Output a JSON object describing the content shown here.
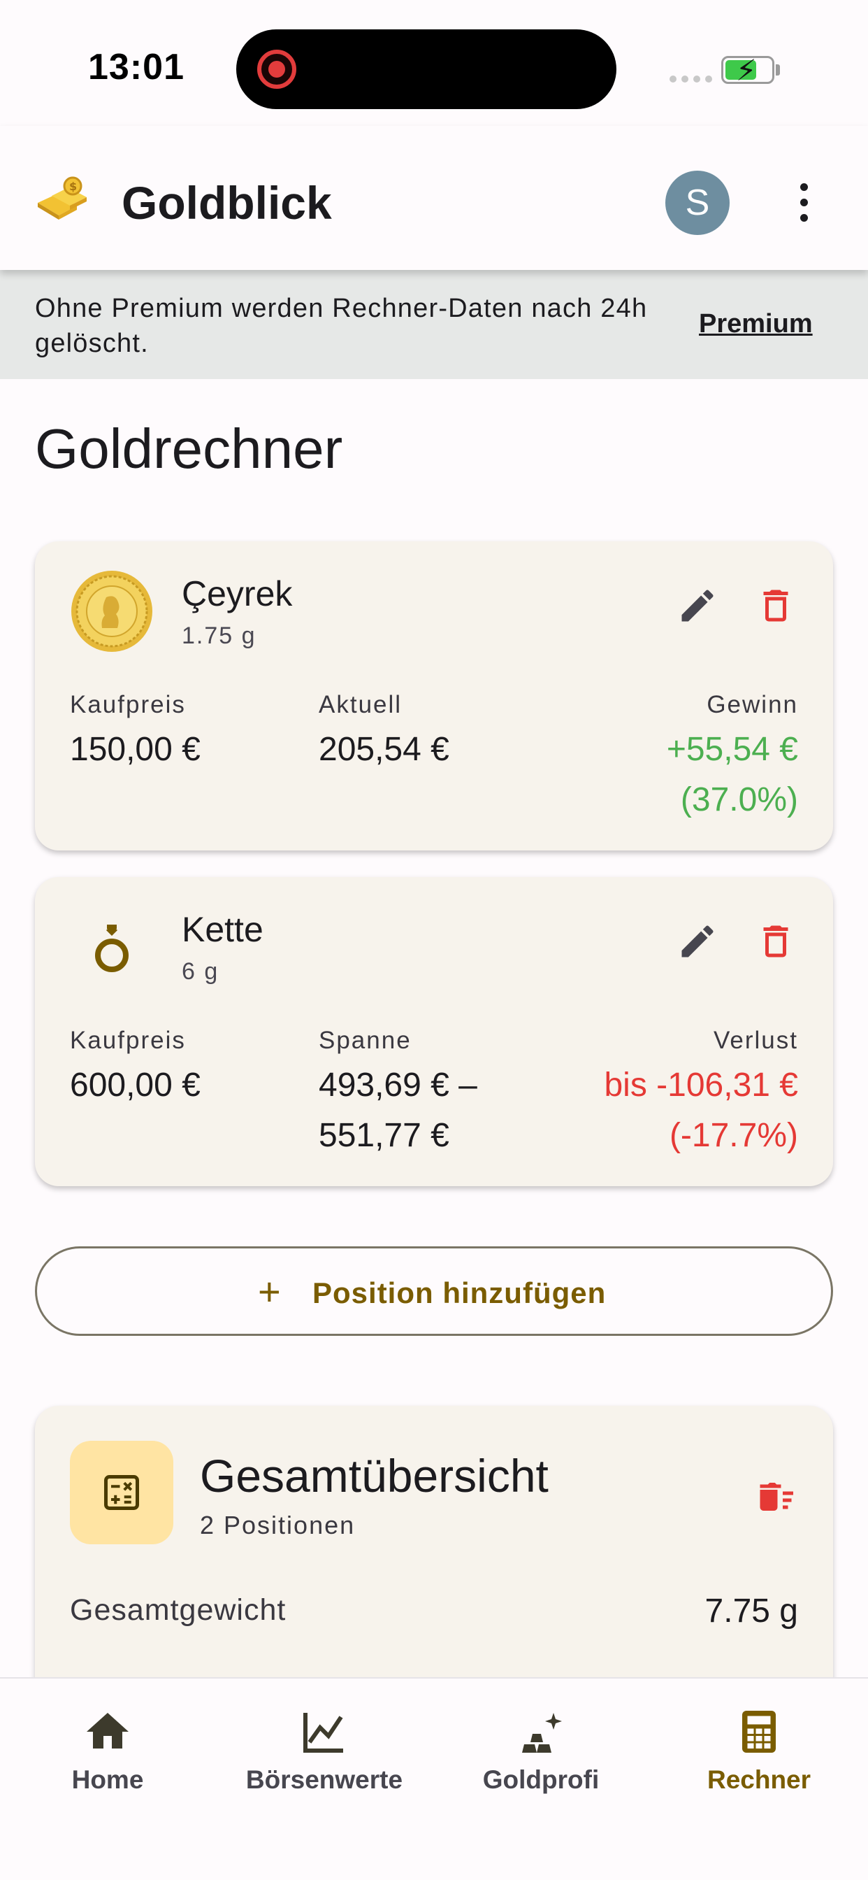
{
  "status_bar": {
    "time": "13:01"
  },
  "app_bar": {
    "title": "Goldblick",
    "avatar_initial": "S"
  },
  "banner": {
    "text": "Ohne Premium werden Rechner-Daten nach 24h gelöscht.",
    "link": "Premium"
  },
  "page": {
    "title": "Goldrechner"
  },
  "positions": [
    {
      "name": "Çeyrek",
      "weight": "1.75 g",
      "icon": "gold-coin-icon",
      "col1_label": "Kaufpreis",
      "col1_value": "150,00 €",
      "col2_label": "Aktuell",
      "col2_value": "205,54 €",
      "col3_label": "Gewinn",
      "col3_value": "+55,54 €",
      "col3_percent": "(37.0%)"
    },
    {
      "name": "Kette",
      "weight": "6 g",
      "icon": "ring-icon",
      "col1_label": "Kaufpreis",
      "col1_value": "600,00 €",
      "col2_label": "Spanne",
      "col2_value": "493,69 € – 551,77 €",
      "col3_label": "Verlust",
      "col3_value": "bis -106,31 €",
      "col3_percent": "(-17.7%)"
    }
  ],
  "add_button": {
    "label": "Position hinzufügen"
  },
  "summary": {
    "title": "Gesamtübersicht",
    "subtitle": "2 Positionen",
    "total_weight_label": "Gesamtgewicht",
    "total_weight_value": "7.75 g"
  },
  "bottom_nav": [
    {
      "label": "Home",
      "icon": "home-icon"
    },
    {
      "label": "Börsenwerte",
      "icon": "chart-icon"
    },
    {
      "label": "Goldprofi",
      "icon": "gold-bars-sparkle-icon"
    },
    {
      "label": "Rechner",
      "icon": "calculator-icon",
      "active": true
    }
  ],
  "colors": {
    "accent": "#7a5c00",
    "gain": "#4caf50",
    "loss": "#e53935",
    "card_bg": "#f7f3ec",
    "banner_bg": "#e6e8e7",
    "summary_icon_bg": "#ffe4a3"
  }
}
